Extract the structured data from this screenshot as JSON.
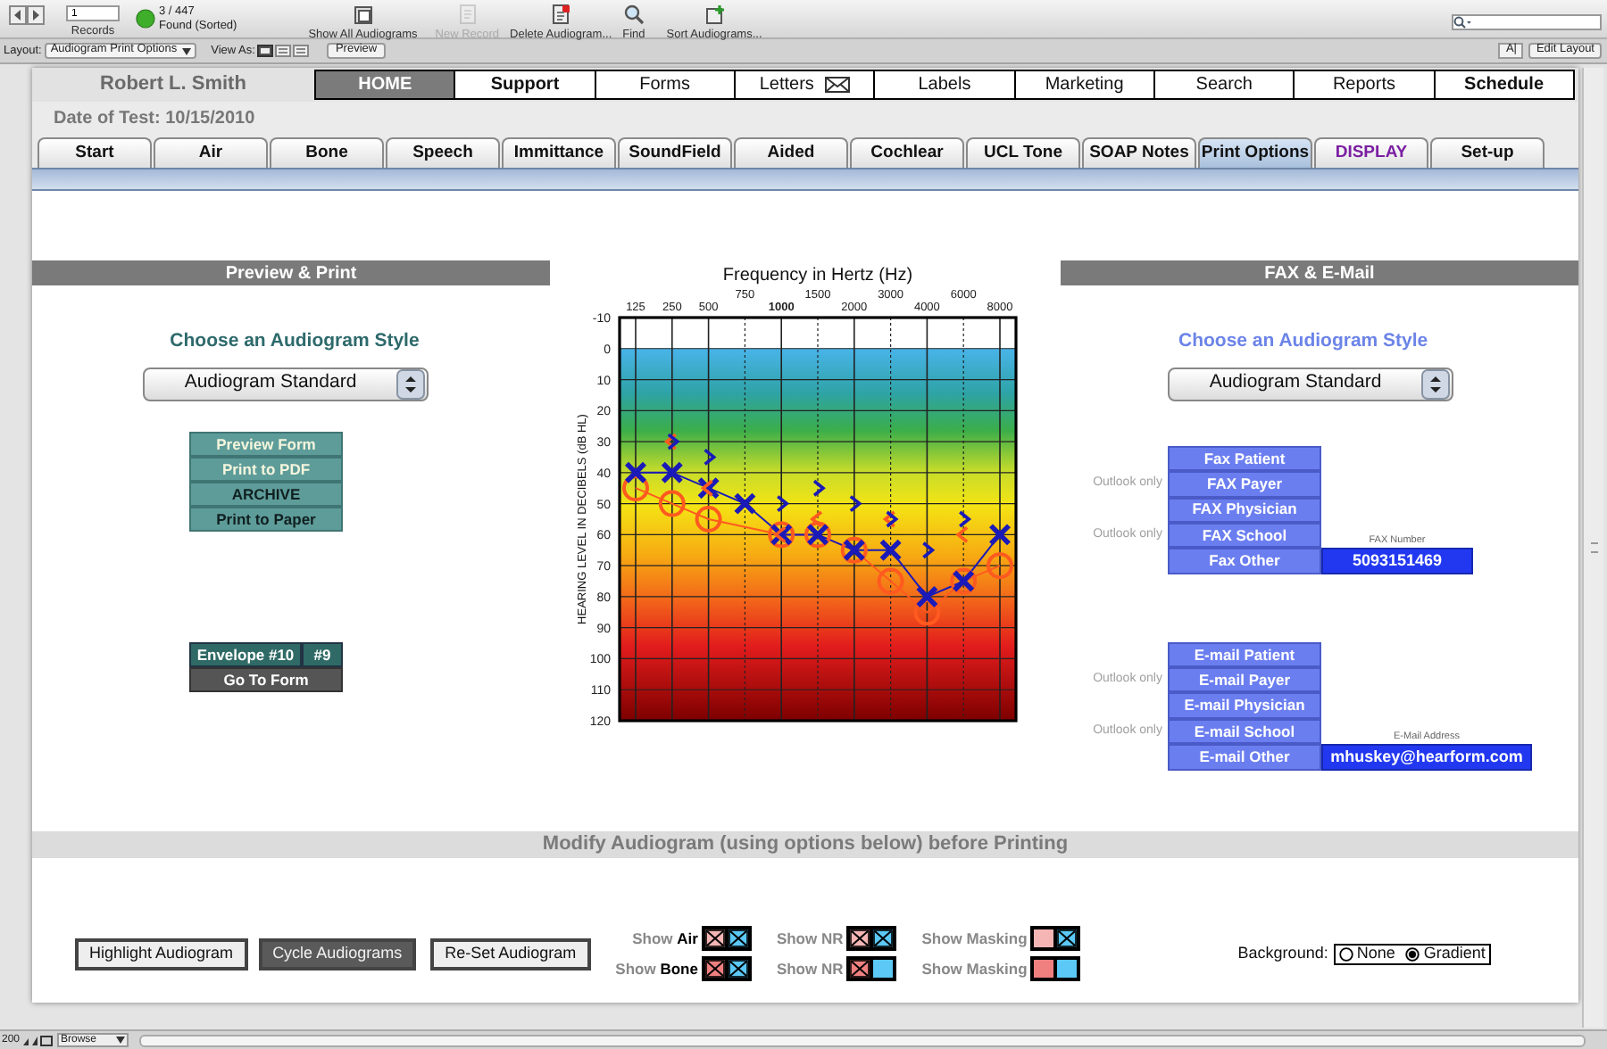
{
  "toolbar": {
    "record_number": "1",
    "records_label": "Records",
    "found_count": "3 / 447",
    "found_status": "Found (Sorted)",
    "actions": [
      {
        "label": "Show All Audiograms",
        "disabled": false
      },
      {
        "label": "New Record",
        "disabled": true
      },
      {
        "label": "Delete Audiogram...",
        "disabled": false
      },
      {
        "label": "Find",
        "disabled": false
      },
      {
        "label": "Sort Audiograms...",
        "disabled": false
      }
    ]
  },
  "layout_bar": {
    "layout_label": "Layout:",
    "layout_value": "Audiogram Print Options",
    "view_label": "View As:",
    "preview_button": "Preview",
    "text_button": "A|",
    "edit_button": "Edit Layout"
  },
  "patient_name": "Robert L. Smith",
  "nav": [
    {
      "label": "HOME",
      "selected": true,
      "bold": true
    },
    {
      "label": "Support",
      "selected": false,
      "bold": true
    },
    {
      "label": "Forms",
      "selected": false,
      "bold": false
    },
    {
      "label": "Letters",
      "selected": false,
      "bold": false,
      "kind": "mail"
    },
    {
      "label": "Labels",
      "selected": false,
      "bold": false
    },
    {
      "label": "Marketing",
      "selected": false,
      "bold": false
    },
    {
      "label": "Search",
      "selected": false,
      "bold": false
    },
    {
      "label": "Reports",
      "selected": false,
      "bold": false
    },
    {
      "label": "Schedule",
      "selected": false,
      "bold": true
    }
  ],
  "date_of_test": "Date of Test: 10/15/2010",
  "tabs": [
    {
      "label": "Start",
      "selected": false,
      "kind": "normal"
    },
    {
      "label": "Air",
      "selected": false,
      "kind": "normal"
    },
    {
      "label": "Bone",
      "selected": false,
      "kind": "normal"
    },
    {
      "label": "Speech",
      "selected": false,
      "kind": "normal"
    },
    {
      "label": "Immittance",
      "selected": false,
      "kind": "normal"
    },
    {
      "label": "SoundField",
      "selected": false,
      "kind": "normal"
    },
    {
      "label": "Aided",
      "selected": false,
      "kind": "normal"
    },
    {
      "label": "Cochlear",
      "selected": false,
      "kind": "normal"
    },
    {
      "label": "UCL Tone",
      "selected": false,
      "kind": "normal"
    },
    {
      "label": "SOAP Notes",
      "selected": false,
      "kind": "normal"
    },
    {
      "label": "Print Options",
      "selected": true,
      "kind": "normal"
    },
    {
      "label": "DISPLAY",
      "selected": false,
      "kind": "accent"
    },
    {
      "label": "Set-up",
      "selected": false,
      "kind": "normal"
    }
  ],
  "preview_print": {
    "title": "Preview & Print",
    "style_label": "Choose an Audiogram Style",
    "style_value": "Audiogram Standard",
    "buttons": [
      {
        "label": "Preview Form",
        "kind": "light"
      },
      {
        "label": "Print to PDF",
        "kind": "light"
      },
      {
        "label": "ARCHIVE",
        "kind": "dark"
      },
      {
        "label": "Print to Paper",
        "kind": "dark"
      }
    ],
    "envelope": [
      "Envelope #10",
      "#9"
    ],
    "go_to_form": "Go To Form"
  },
  "chart": {
    "chart_data": {
      "type": "line",
      "title": "Frequency in Hertz (Hz)",
      "ylabel": "HEARING LEVEL IN DECIBELS (dB HL)",
      "categories": [
        "125",
        "250",
        "500",
        "750",
        "1000",
        "1500",
        "2000",
        "3000",
        "4000",
        "6000",
        "8000"
      ],
      "grid": true,
      "ylim": [
        120,
        -10
      ],
      "yticks": [
        -10,
        0,
        10,
        20,
        30,
        40,
        50,
        60,
        70,
        80,
        90,
        100,
        110,
        120
      ],
      "series": [
        {
          "color": "#ff5a1f",
          "marker": "circle",
          "values": [
            45,
            50,
            55,
            null,
            60,
            60,
            65,
            75,
            85,
            75,
            70
          ]
        },
        {
          "color": "#1a1ab8",
          "marker": "cross",
          "values": [
            40,
            40,
            45,
            50,
            60,
            60,
            65,
            65,
            80,
            75,
            60
          ]
        },
        {
          "color": "#ff5a1f",
          "type": "scatter",
          "values": [
            null,
            30,
            45,
            null,
            60,
            55,
            null,
            55,
            null,
            60,
            null
          ]
        },
        {
          "color": "#1a1ab8",
          "type": "scatter",
          "values": [
            null,
            30,
            35,
            null,
            50,
            45,
            50,
            55,
            65,
            55,
            null
          ]
        }
      ]
    }
  },
  "fax_email": {
    "title": "FAX & E-Mail",
    "style_label": "Choose an Audiogram Style",
    "style_value": "Audiogram Standard",
    "fax_buttons": [
      {
        "label": "Fax Patient"
      },
      {
        "label": "FAX Payer",
        "note": "Outlook only"
      },
      {
        "label": "FAX Physician"
      },
      {
        "label": "FAX School",
        "note": "Outlook only"
      },
      {
        "label": "Fax Other"
      }
    ],
    "fax_field": {
      "label": "FAX Number",
      "value": "5093151469"
    },
    "email_buttons": [
      {
        "label": "E-mail Patient"
      },
      {
        "label": "E-mail Payer",
        "note": "Outlook only"
      },
      {
        "label": "E-mail Physician"
      },
      {
        "label": "E-mail School",
        "note": "Outlook only"
      },
      {
        "label": "E-mail Other"
      }
    ],
    "email_field": {
      "label": "E-Mail Address",
      "value": "mhuskey@hearform.com"
    }
  },
  "modify": {
    "title": "Modify Audiogram (using options below) before Printing",
    "buttons": [
      {
        "label": "Highlight Audiogram",
        "selected": false
      },
      {
        "label": "Cycle Audiograms",
        "selected": true
      },
      {
        "label": "Re-Set Audiogram",
        "selected": false
      }
    ],
    "toggles": [
      {
        "label": "Show **Air**",
        "boxes": [
          {
            "color": "#f5b5b5",
            "checked": true
          },
          {
            "color": "#5bc8f5",
            "checked": true
          }
        ]
      },
      {
        "label": "Show NR",
        "boxes": [
          {
            "color": "#f5b5b5",
            "checked": true
          },
          {
            "color": "#5bc8f5",
            "checked": true
          }
        ]
      },
      {
        "label": "Show Masking",
        "boxes": [
          {
            "color": "#f5b5b5",
            "checked": false
          },
          {
            "color": "#5bc8f5",
            "checked": true
          }
        ]
      },
      {
        "label": "Show **Bone**",
        "boxes": [
          {
            "color": "#f08080",
            "checked": true
          },
          {
            "color": "#5bc8f5",
            "checked": true
          }
        ]
      },
      {
        "label": "Show NR",
        "boxes": [
          {
            "color": "#f08080",
            "checked": true
          },
          {
            "color": "#5bc8f5",
            "checked": false
          }
        ]
      },
      {
        "label": "Show Masking",
        "boxes": [
          {
            "color": "#f08080",
            "checked": false
          },
          {
            "color": "#5bc8f5",
            "checked": false
          }
        ]
      }
    ],
    "background": {
      "label": "Background:",
      "options": [
        {
          "label": "None",
          "selected": false,
          "kind": "none"
        },
        {
          "label": "Gradient",
          "selected": true,
          "kind": "gradient"
        }
      ]
    }
  },
  "status_bar": {
    "zoom": "200",
    "mode": "Browse"
  }
}
